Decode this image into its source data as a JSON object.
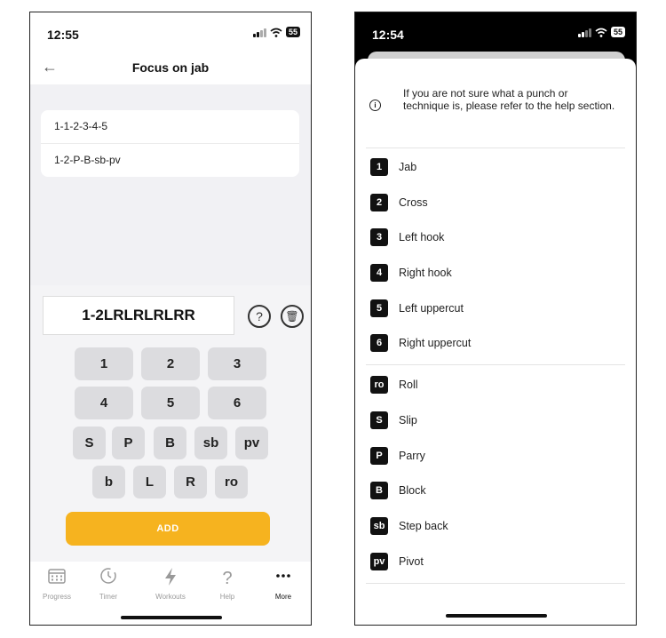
{
  "left": {
    "status": {
      "time": "12:55",
      "battery": "55"
    },
    "header": {
      "title": "Focus on jab",
      "back_icon": "←"
    },
    "combos": [
      "1-1-2-3-4-5",
      "1-2-P-B-sb-pv"
    ],
    "editor": {
      "input_value": "1-2LRLRLRLRR",
      "help_icon": "?",
      "delete_icon": "🗑",
      "keys_row1": [
        "1",
        "2",
        "3"
      ],
      "keys_row2": [
        "4",
        "5",
        "6"
      ],
      "keys_row3": [
        "S",
        "P",
        "B",
        "sb",
        "pv"
      ],
      "keys_row4": [
        "b",
        "L",
        "R",
        "ro"
      ],
      "add_label": "ADD"
    },
    "tabbar": [
      {
        "label": "Progress",
        "icon": "calendar-icon"
      },
      {
        "label": "Timer",
        "icon": "timer-icon"
      },
      {
        "label": "Workouts",
        "icon": "lightning-icon"
      },
      {
        "label": "Help",
        "icon": "question-icon"
      },
      {
        "label": "More",
        "icon": "more-icon"
      }
    ],
    "active_tab": "More"
  },
  "right": {
    "status": {
      "time": "12:54",
      "battery": "55"
    },
    "info_text": "If you are not sure what a punch or technique is, please refer to the help section.",
    "punches": [
      {
        "badge": "1",
        "name": "Jab"
      },
      {
        "badge": "2",
        "name": "Cross"
      },
      {
        "badge": "3",
        "name": "Left hook"
      },
      {
        "badge": "4",
        "name": "Right hook"
      },
      {
        "badge": "5",
        "name": "Left uppercut"
      },
      {
        "badge": "6",
        "name": "Right uppercut"
      }
    ],
    "techniques": [
      {
        "badge": "ro",
        "name": "Roll"
      },
      {
        "badge": "S",
        "name": "Slip"
      },
      {
        "badge": "P",
        "name": "Parry"
      },
      {
        "badge": "B",
        "name": "Block"
      },
      {
        "badge": "sb",
        "name": "Step back"
      },
      {
        "badge": "pv",
        "name": "Pivot"
      }
    ]
  },
  "colors": {
    "accent": "#f6b31f",
    "key_bg": "#dcdcdf",
    "badge_bg": "#111111"
  }
}
